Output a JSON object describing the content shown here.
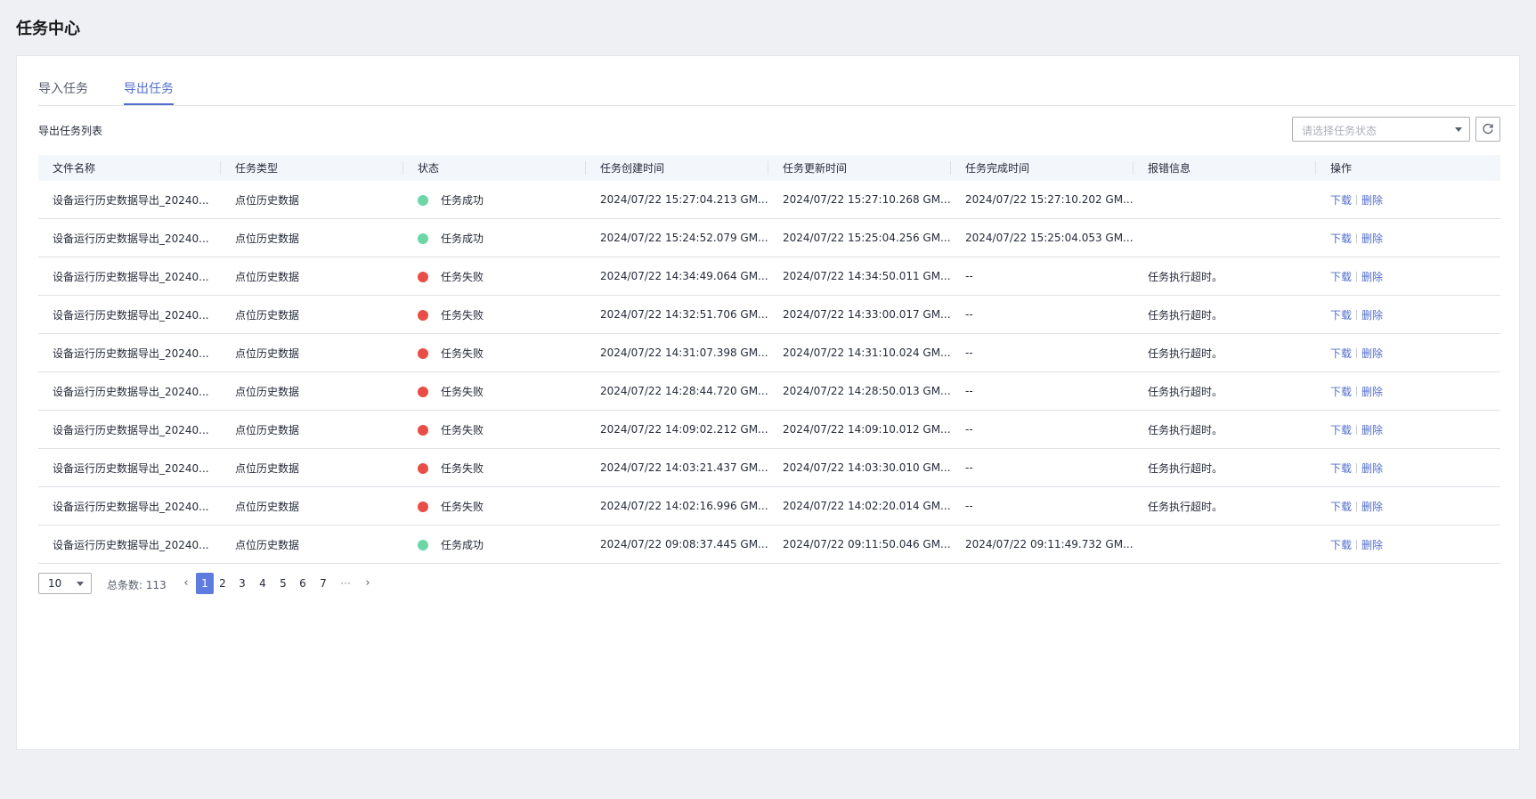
{
  "page": {
    "title": "任务中心"
  },
  "tabs": [
    {
      "label": "导入任务",
      "active": false
    },
    {
      "label": "导出任务",
      "active": true
    }
  ],
  "toolbar": {
    "list_title": "导出任务列表",
    "status_placeholder": "请选择任务状态",
    "refresh_icon": "refresh-icon"
  },
  "colors": {
    "accent": "#526ecc",
    "success": "#6cd6a7",
    "failure": "#e84e47"
  },
  "table": {
    "columns": [
      "文件名称",
      "任务类型",
      "状态",
      "任务创建时间",
      "任务更新时间",
      "任务完成时间",
      "报错信息",
      "操作"
    ],
    "action_download": "下载",
    "action_delete": "删除",
    "rows": [
      {
        "file": "设备运行历史数据导出_20240...",
        "type": "点位历史数据",
        "status": "任务成功",
        "status_kind": "success",
        "created": "2024/07/22 15:27:04.213 GM...",
        "updated": "2024/07/22 15:27:10.268 GM...",
        "finished": "2024/07/22 15:27:10.202 GM...",
        "error": ""
      },
      {
        "file": "设备运行历史数据导出_20240...",
        "type": "点位历史数据",
        "status": "任务成功",
        "status_kind": "success",
        "created": "2024/07/22 15:24:52.079 GM...",
        "updated": "2024/07/22 15:25:04.256 GM...",
        "finished": "2024/07/22 15:25:04.053 GM...",
        "error": ""
      },
      {
        "file": "设备运行历史数据导出_20240...",
        "type": "点位历史数据",
        "status": "任务失败",
        "status_kind": "failure",
        "created": "2024/07/22 14:34:49.064 GM...",
        "updated": "2024/07/22 14:34:50.011 GM...",
        "finished": "--",
        "error": "任务执行超时。"
      },
      {
        "file": "设备运行历史数据导出_20240...",
        "type": "点位历史数据",
        "status": "任务失败",
        "status_kind": "failure",
        "created": "2024/07/22 14:32:51.706 GM...",
        "updated": "2024/07/22 14:33:00.017 GM...",
        "finished": "--",
        "error": "任务执行超时。"
      },
      {
        "file": "设备运行历史数据导出_20240...",
        "type": "点位历史数据",
        "status": "任务失败",
        "status_kind": "failure",
        "created": "2024/07/22 14:31:07.398 GM...",
        "updated": "2024/07/22 14:31:10.024 GM...",
        "finished": "--",
        "error": "任务执行超时。"
      },
      {
        "file": "设备运行历史数据导出_20240...",
        "type": "点位历史数据",
        "status": "任务失败",
        "status_kind": "failure",
        "created": "2024/07/22 14:28:44.720 GM...",
        "updated": "2024/07/22 14:28:50.013 GM...",
        "finished": "--",
        "error": "任务执行超时。"
      },
      {
        "file": "设备运行历史数据导出_20240...",
        "type": "点位历史数据",
        "status": "任务失败",
        "status_kind": "failure",
        "created": "2024/07/22 14:09:02.212 GM...",
        "updated": "2024/07/22 14:09:10.012 GM...",
        "finished": "--",
        "error": "任务执行超时。"
      },
      {
        "file": "设备运行历史数据导出_20240...",
        "type": "点位历史数据",
        "status": "任务失败",
        "status_kind": "failure",
        "created": "2024/07/22 14:03:21.437 GM...",
        "updated": "2024/07/22 14:03:30.010 GM...",
        "finished": "--",
        "error": "任务执行超时。"
      },
      {
        "file": "设备运行历史数据导出_20240...",
        "type": "点位历史数据",
        "status": "任务失败",
        "status_kind": "failure",
        "created": "2024/07/22 14:02:16.996 GM...",
        "updated": "2024/07/22 14:02:20.014 GM...",
        "finished": "--",
        "error": "任务执行超时。"
      },
      {
        "file": "设备运行历史数据导出_20240...",
        "type": "点位历史数据",
        "status": "任务成功",
        "status_kind": "success",
        "created": "2024/07/22 09:08:37.445 GM...",
        "updated": "2024/07/22 09:11:50.046 GM...",
        "finished": "2024/07/22 09:11:49.732 GM...",
        "error": ""
      }
    ]
  },
  "pagination": {
    "page_size": "10",
    "total_label": "总条数: 113",
    "pages": [
      "1",
      "2",
      "3",
      "4",
      "5",
      "6",
      "7"
    ],
    "current": "1",
    "ellipsis": "···",
    "prev_icon": "chevron-left-icon",
    "next_icon": "chevron-right-icon"
  }
}
